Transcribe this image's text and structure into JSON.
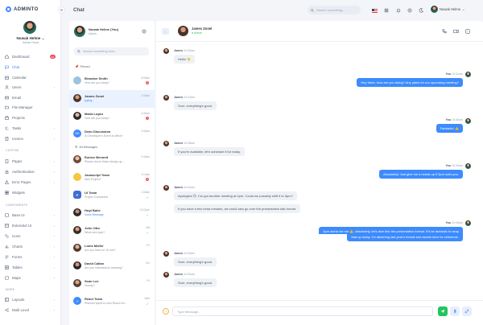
{
  "brand": {
    "name": "ADMINTO"
  },
  "profile": {
    "name": "Nowak Helme",
    "role": "Admin Head"
  },
  "sidebar": {
    "items": [
      {
        "label": "Dashboard",
        "icon": "home-icon",
        "badge": "01"
      },
      {
        "label": "Chat",
        "icon": "chat-icon"
      },
      {
        "label": "Calendar",
        "icon": "calendar-icon"
      },
      {
        "label": "Users",
        "icon": "users-icon"
      },
      {
        "label": "Email",
        "icon": "mail-icon"
      },
      {
        "label": "File Manager",
        "icon": "folder-icon"
      },
      {
        "label": "Projects",
        "icon": "briefcase-icon"
      },
      {
        "label": "Tasks",
        "icon": "tasks-icon"
      },
      {
        "label": "Invoice",
        "icon": "invoice-icon"
      },
      {
        "label": "Pages",
        "icon": "pages-icon"
      },
      {
        "label": "Authentication",
        "icon": "lock-icon"
      },
      {
        "label": "Error Pages",
        "icon": "alert-icon"
      },
      {
        "label": "Widgets",
        "icon": "widgets-icon"
      },
      {
        "label": "Base UI",
        "icon": "base-ui-icon"
      },
      {
        "label": "Extended UI",
        "icon": "extended-ui-icon"
      },
      {
        "label": "Icons",
        "icon": "icons-icon"
      },
      {
        "label": "Charts",
        "icon": "chart-icon"
      },
      {
        "label": "Forms",
        "icon": "forms-icon"
      },
      {
        "label": "Tables",
        "icon": "table-icon"
      },
      {
        "label": "Maps",
        "icon": "map-icon"
      },
      {
        "label": "Layouts",
        "icon": "layout-icon"
      },
      {
        "label": "Multi Level",
        "icon": "share-icon"
      }
    ],
    "sections": {
      "custom": "CUSTOM",
      "components": "COMPONENTS",
      "more": "MORE"
    }
  },
  "topbar": {
    "title": "Chat",
    "search_placeholder": "Search something...",
    "user": "Nowak Helme"
  },
  "chat_list": {
    "me": {
      "name": "Nowak Helme (You)",
      "role": "Admin"
    },
    "search_placeholder": "Search something here...",
    "pinned_label": "Pinned",
    "all_label": "All Messages",
    "pinned": [
      {
        "name": "Brandon Smith",
        "preview": "How are you today?",
        "time": "5:50am",
        "badge": "2"
      },
      {
        "name": "James Zonei",
        "preview": "typing...",
        "time": "4:30am"
      },
      {
        "name": "Maria Lopez",
        "preview": "How are you today?",
        "time": "4:30pm",
        "badge": "1"
      },
      {
        "name": "Dean Discussion",
        "preview": "ID Developer's Event in office?",
        "time": "3:30pm"
      }
    ],
    "all": [
      {
        "name": "Eunice Bennett",
        "preview": "Please check these design up...",
        "time": "2:40am"
      },
      {
        "name": "Javascript Team",
        "preview": "New Project?",
        "time": "2:10am",
        "badge": "3"
      },
      {
        "name": "UI Team",
        "preview": "Project Completed",
        "time": "1:30am"
      },
      {
        "name": "Hoyt Bahe",
        "preview": "Voice Message",
        "time": "11:02pm"
      },
      {
        "name": "John Otto",
        "preview": "What next plan?",
        "time": "Sat"
      },
      {
        "name": "Louis Moller",
        "preview": "Are you hear for 10 min?",
        "time": "Fri"
      },
      {
        "name": "David Callan",
        "preview": "Are you interested in learning?",
        "time": "Tue"
      },
      {
        "name": "Sean Lee",
        "preview": "Howdy?",
        "time": "Fri"
      },
      {
        "name": "React Team",
        "preview": "Planned sprint to new React em...",
        "time": "Wed"
      }
    ]
  },
  "conversation": {
    "contact": {
      "name": "James Zonel",
      "status": "Active"
    },
    "messages": [
      {
        "sender": "James",
        "time": "10:30am",
        "text": "Hello! 👋"
      },
      {
        "sender": "You",
        "time": "10:31am",
        "text": "Hey there, how are you doing? Any plans for our upcoming meeting?"
      },
      {
        "sender": "James",
        "time": "10:33am",
        "text": "Sure, everything's good."
      },
      {
        "sender": "You",
        "time": "10:35am",
        "text": "Fantastic! 👍"
      },
      {
        "sender": "James",
        "time": "10:38am",
        "text": "If you're available, let's schedule it for today."
      },
      {
        "sender": "You",
        "time": "10:40am",
        "text": "Absolutely! Just give me a heads up if 2pm suits you."
      },
      {
        "sender": "James",
        "time": "10:42am",
        "text": "Apologies 😥, I've got another meeting at 2pm. Could we possibly shift it to 3pm?"
      },
      {
        "sender": "James",
        "time": "",
        "text": "If you have a few extra minutes, we could also go over the presentation talk format."
      },
      {
        "sender": "You",
        "time": "10:45am",
        "text": "3pm works for me 👍. Absolutely, let's dive into the presentation format. It'd be fantastic to wrap"
      },
      {
        "sender": "You",
        "time": "",
        "text": "that up today. I'm attaching last year's format and assets here for reference."
      },
      {
        "sender": "James",
        "time": "10:50am",
        "text": "Sure, everything's good."
      },
      {
        "sender": "James",
        "time": "10:50am",
        "text": "Sure, everything's good."
      }
    ],
    "compose_placeholder": "Type Message..."
  },
  "colors": {
    "primary": "#3d8bfd",
    "danger": "#f44f5e",
    "success": "#22c55e"
  }
}
